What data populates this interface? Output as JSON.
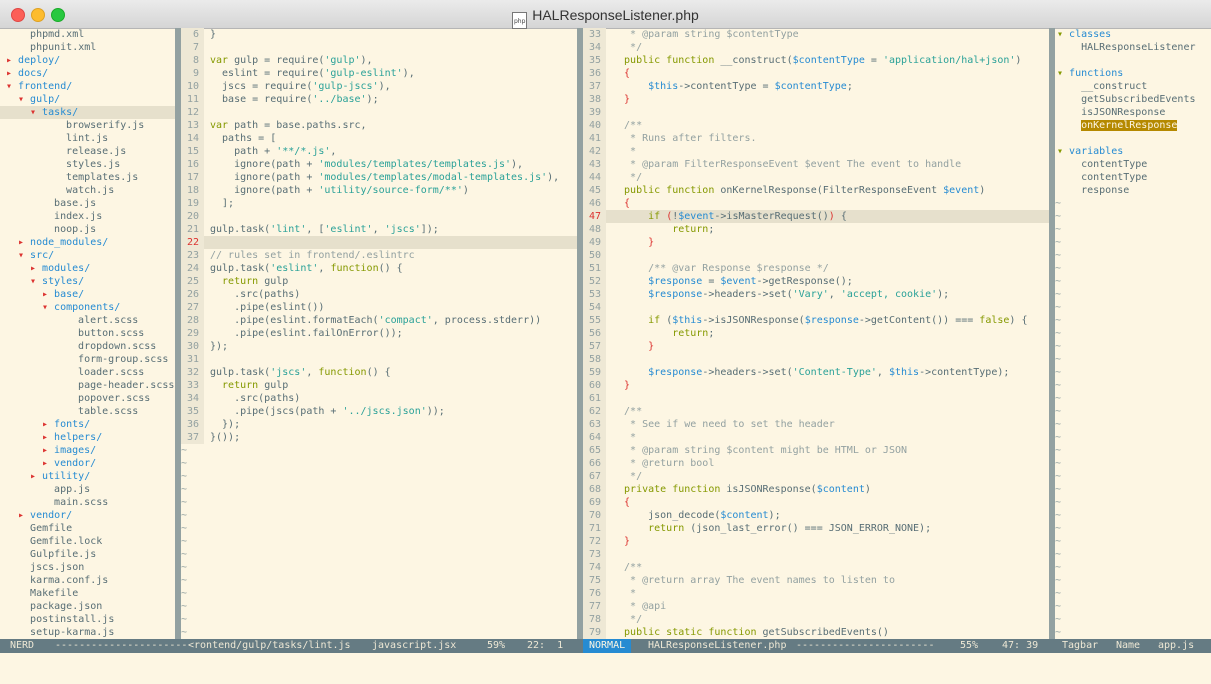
{
  "window": {
    "title": "HALResponseListener.php"
  },
  "tree": [
    {
      "i": 1,
      "t": "phpmd.xml",
      "k": "f"
    },
    {
      "i": 1,
      "t": "phpunit.xml",
      "k": "f"
    },
    {
      "i": 0,
      "t": "deploy/",
      "k": "dc"
    },
    {
      "i": 0,
      "t": "docs/",
      "k": "dc"
    },
    {
      "i": 0,
      "t": "frontend/",
      "k": "do"
    },
    {
      "i": 1,
      "t": "gulp/",
      "k": "do"
    },
    {
      "i": 2,
      "t": "tasks/",
      "k": "do",
      "cur": true
    },
    {
      "i": 4,
      "t": "browserify.js",
      "k": "f"
    },
    {
      "i": 4,
      "t": "lint.js",
      "k": "f"
    },
    {
      "i": 4,
      "t": "release.js",
      "k": "f"
    },
    {
      "i": 4,
      "t": "styles.js",
      "k": "f"
    },
    {
      "i": 4,
      "t": "templates.js",
      "k": "f"
    },
    {
      "i": 4,
      "t": "watch.js",
      "k": "f"
    },
    {
      "i": 3,
      "t": "base.js",
      "k": "f"
    },
    {
      "i": 3,
      "t": "index.js",
      "k": "f"
    },
    {
      "i": 3,
      "t": "noop.js",
      "k": "f"
    },
    {
      "i": 1,
      "t": "node_modules/",
      "k": "dc"
    },
    {
      "i": 1,
      "t": "src/",
      "k": "do"
    },
    {
      "i": 2,
      "t": "modules/",
      "k": "dc"
    },
    {
      "i": 2,
      "t": "styles/",
      "k": "do"
    },
    {
      "i": 3,
      "t": "base/",
      "k": "dc"
    },
    {
      "i": 3,
      "t": "components/",
      "k": "do"
    },
    {
      "i": 5,
      "t": "alert.scss",
      "k": "f"
    },
    {
      "i": 5,
      "t": "button.scss",
      "k": "f"
    },
    {
      "i": 5,
      "t": "dropdown.scss",
      "k": "f"
    },
    {
      "i": 5,
      "t": "form-group.scss",
      "k": "f"
    },
    {
      "i": 5,
      "t": "loader.scss",
      "k": "f"
    },
    {
      "i": 5,
      "t": "page-header.scss",
      "k": "f"
    },
    {
      "i": 5,
      "t": "popover.scss",
      "k": "f"
    },
    {
      "i": 5,
      "t": "table.scss",
      "k": "f"
    },
    {
      "i": 3,
      "t": "fonts/",
      "k": "dc"
    },
    {
      "i": 3,
      "t": "helpers/",
      "k": "dc"
    },
    {
      "i": 3,
      "t": "images/",
      "k": "dc"
    },
    {
      "i": 3,
      "t": "vendor/",
      "k": "dc"
    },
    {
      "i": 2,
      "t": "utility/",
      "k": "dc"
    },
    {
      "i": 3,
      "t": "app.js",
      "k": "f"
    },
    {
      "i": 3,
      "t": "main.scss",
      "k": "f"
    },
    {
      "i": 1,
      "t": "vendor/",
      "k": "dc"
    },
    {
      "i": 1,
      "t": "Gemfile",
      "k": "f"
    },
    {
      "i": 1,
      "t": "Gemfile.lock",
      "k": "f"
    },
    {
      "i": 1,
      "t": "Gulpfile.js",
      "k": "f"
    },
    {
      "i": 1,
      "t": "jscs.json",
      "k": "f"
    },
    {
      "i": 1,
      "t": "karma.conf.js",
      "k": "f"
    },
    {
      "i": 1,
      "t": "Makefile",
      "k": "f"
    },
    {
      "i": 1,
      "t": "package.json",
      "k": "f"
    },
    {
      "i": 1,
      "t": "postinstall.js",
      "k": "f"
    },
    {
      "i": 1,
      "t": "setup-karma.js",
      "k": "f"
    }
  ],
  "js": [
    {
      "n": 6,
      "s": [
        [
          "tx",
          "}"
        ]
      ]
    },
    {
      "n": 7,
      "s": []
    },
    {
      "n": 8,
      "s": [
        [
          "kw",
          "var"
        ],
        [
          "tx",
          " gulp = require("
        ],
        [
          "str",
          "'gulp'"
        ],
        [
          "tx",
          "),"
        ]
      ]
    },
    {
      "n": 9,
      "s": [
        [
          "tx",
          "  eslint = require("
        ],
        [
          "str",
          "'gulp-eslint'"
        ],
        [
          "tx",
          "),"
        ]
      ]
    },
    {
      "n": 10,
      "s": [
        [
          "tx",
          "  jscs = require("
        ],
        [
          "str",
          "'gulp-jscs'"
        ],
        [
          "tx",
          "),"
        ]
      ]
    },
    {
      "n": 11,
      "s": [
        [
          "tx",
          "  base = require("
        ],
        [
          "str",
          "'../base'"
        ],
        [
          "tx",
          ");"
        ]
      ]
    },
    {
      "n": 12,
      "s": []
    },
    {
      "n": 13,
      "s": [
        [
          "kw",
          "var"
        ],
        [
          "tx",
          " path = base.paths.src,"
        ]
      ]
    },
    {
      "n": 14,
      "s": [
        [
          "tx",
          "  paths = ["
        ]
      ]
    },
    {
      "n": 15,
      "s": [
        [
          "tx",
          "    path + "
        ],
        [
          "str",
          "'**/*.js'"
        ],
        [
          "tx",
          ","
        ]
      ]
    },
    {
      "n": 16,
      "s": [
        [
          "tx",
          "    ignore(path + "
        ],
        [
          "str",
          "'modules/templates/templates.js'"
        ],
        [
          "tx",
          "),"
        ]
      ]
    },
    {
      "n": 17,
      "s": [
        [
          "tx",
          "    ignore(path + "
        ],
        [
          "str",
          "'modules/templates/modal-templates.js'"
        ],
        [
          "tx",
          "),"
        ]
      ]
    },
    {
      "n": 18,
      "s": [
        [
          "tx",
          "    ignore(path + "
        ],
        [
          "str",
          "'utility/source-form/**'"
        ],
        [
          "tx",
          ")"
        ]
      ]
    },
    {
      "n": 19,
      "s": [
        [
          "tx",
          "  ];"
        ]
      ]
    },
    {
      "n": 20,
      "s": []
    },
    {
      "n": 21,
      "s": [
        [
          "tx",
          "gulp.task("
        ],
        [
          "str",
          "'lint'"
        ],
        [
          "tx",
          ", ["
        ],
        [
          "str",
          "'eslint'"
        ],
        [
          "tx",
          ", "
        ],
        [
          "str",
          "'jscs'"
        ],
        [
          "tx",
          "]);"
        ]
      ]
    },
    {
      "n": 22,
      "s": [],
      "cur": true
    },
    {
      "n": 23,
      "s": [
        [
          "cm",
          "// rules set in frontend/.eslintrc"
        ]
      ]
    },
    {
      "n": 24,
      "s": [
        [
          "tx",
          "gulp.task("
        ],
        [
          "str",
          "'eslint'"
        ],
        [
          "tx",
          ", "
        ],
        [
          "kw",
          "function"
        ],
        [
          "tx",
          "() {"
        ]
      ]
    },
    {
      "n": 25,
      "s": [
        [
          "kw",
          "  return"
        ],
        [
          "tx",
          " gulp"
        ]
      ]
    },
    {
      "n": 26,
      "s": [
        [
          "tx",
          "    .src(paths)"
        ]
      ]
    },
    {
      "n": 27,
      "s": [
        [
          "tx",
          "    .pipe(eslint())"
        ]
      ]
    },
    {
      "n": 28,
      "s": [
        [
          "tx",
          "    .pipe(eslint.formatEach("
        ],
        [
          "str",
          "'compact'"
        ],
        [
          "tx",
          ", process.stderr))"
        ]
      ]
    },
    {
      "n": 29,
      "s": [
        [
          "tx",
          "    .pipe(eslint.failOnError());"
        ]
      ]
    },
    {
      "n": 30,
      "s": [
        [
          "tx",
          "});"
        ]
      ]
    },
    {
      "n": 31,
      "s": []
    },
    {
      "n": 32,
      "s": [
        [
          "tx",
          "gulp.task("
        ],
        [
          "str",
          "'jscs'"
        ],
        [
          "tx",
          ", "
        ],
        [
          "kw",
          "function"
        ],
        [
          "tx",
          "() {"
        ]
      ]
    },
    {
      "n": 33,
      "s": [
        [
          "kw",
          "  return"
        ],
        [
          "tx",
          " gulp"
        ]
      ]
    },
    {
      "n": 34,
      "s": [
        [
          "tx",
          "    .src(paths)"
        ]
      ]
    },
    {
      "n": 35,
      "s": [
        [
          "tx",
          "    .pipe(jscs(path + "
        ],
        [
          "str",
          "'../jscs.json'"
        ],
        [
          "tx",
          "));"
        ]
      ]
    },
    {
      "n": 36,
      "s": [
        [
          "tx",
          "  });"
        ]
      ]
    },
    {
      "n": 37,
      "s": [
        [
          "tx",
          "}());"
        ]
      ]
    }
  ],
  "php": [
    {
      "n": 33,
      "s": [
        [
          "cm",
          "   * @param string $contentType"
        ]
      ]
    },
    {
      "n": 34,
      "s": [
        [
          "cm",
          "   */"
        ]
      ]
    },
    {
      "n": 35,
      "s": [
        [
          "kw",
          "  public function"
        ],
        [
          "tx",
          " __construct("
        ],
        [
          "var",
          "$contentType"
        ],
        [
          "tx",
          " = "
        ],
        [
          "str",
          "'application/hal+json'"
        ],
        [
          "tx",
          ")"
        ]
      ]
    },
    {
      "n": 36,
      "s": [
        [
          "arr",
          "  {"
        ]
      ]
    },
    {
      "n": 37,
      "s": [
        [
          "tx",
          "      "
        ],
        [
          "var",
          "$this"
        ],
        [
          "tx",
          "->contentType = "
        ],
        [
          "var",
          "$contentType"
        ],
        [
          "tx",
          ";"
        ]
      ]
    },
    {
      "n": 38,
      "s": [
        [
          "arr",
          "  }"
        ]
      ]
    },
    {
      "n": 39,
      "s": []
    },
    {
      "n": 40,
      "s": [
        [
          "cm",
          "  /**"
        ]
      ]
    },
    {
      "n": 41,
      "s": [
        [
          "cm",
          "   * Runs after filters."
        ]
      ]
    },
    {
      "n": 42,
      "s": [
        [
          "cm",
          "   *"
        ]
      ]
    },
    {
      "n": 43,
      "s": [
        [
          "cm",
          "   * @param FilterResponseEvent $event The event to handle"
        ]
      ]
    },
    {
      "n": 44,
      "s": [
        [
          "cm",
          "   */"
        ]
      ]
    },
    {
      "n": 45,
      "s": [
        [
          "kw",
          "  public function"
        ],
        [
          "tx",
          " onKernelResponse(FilterResponseEvent "
        ],
        [
          "var",
          "$event"
        ],
        [
          "tx",
          ")"
        ]
      ]
    },
    {
      "n": 46,
      "s": [
        [
          "arr",
          "  {"
        ]
      ]
    },
    {
      "n": 47,
      "s": [
        [
          "kw",
          "      if"
        ],
        [
          "tx",
          " "
        ],
        [
          "arr",
          "("
        ],
        [
          "tx",
          "!"
        ],
        [
          "var",
          "$event"
        ],
        [
          "tx",
          "->isMasterRequest()"
        ],
        [
          "arr",
          ")"
        ],
        [
          "tx",
          " {"
        ]
      ],
      "cur": true
    },
    {
      "n": 48,
      "s": [
        [
          "kw",
          "          return"
        ],
        [
          "tx",
          ";"
        ]
      ]
    },
    {
      "n": 49,
      "s": [
        [
          "arr",
          "      }"
        ]
      ]
    },
    {
      "n": 50,
      "s": []
    },
    {
      "n": 51,
      "s": [
        [
          "cm",
          "      /** @var Response $response */"
        ]
      ]
    },
    {
      "n": 52,
      "s": [
        [
          "tx",
          "      "
        ],
        [
          "var",
          "$response"
        ],
        [
          "tx",
          " = "
        ],
        [
          "var",
          "$event"
        ],
        [
          "tx",
          "->getResponse();"
        ]
      ]
    },
    {
      "n": 53,
      "s": [
        [
          "tx",
          "      "
        ],
        [
          "var",
          "$response"
        ],
        [
          "tx",
          "->headers->set("
        ],
        [
          "str",
          "'Vary'"
        ],
        [
          "tx",
          ", "
        ],
        [
          "str",
          "'accept, cookie'"
        ],
        [
          "tx",
          ");"
        ]
      ]
    },
    {
      "n": 54,
      "s": []
    },
    {
      "n": 55,
      "s": [
        [
          "kw",
          "      if"
        ],
        [
          "tx",
          " ("
        ],
        [
          "var",
          "$this"
        ],
        [
          "tx",
          "->isJSONResponse("
        ],
        [
          "var",
          "$response"
        ],
        [
          "tx",
          "->getContent()) === "
        ],
        [
          "kw",
          "false"
        ],
        [
          "tx",
          ") {"
        ]
      ]
    },
    {
      "n": 56,
      "s": [
        [
          "kw",
          "          return"
        ],
        [
          "tx",
          ";"
        ]
      ]
    },
    {
      "n": 57,
      "s": [
        [
          "arr",
          "      }"
        ]
      ]
    },
    {
      "n": 58,
      "s": []
    },
    {
      "n": 59,
      "s": [
        [
          "tx",
          "      "
        ],
        [
          "var",
          "$response"
        ],
        [
          "tx",
          "->headers->set("
        ],
        [
          "str",
          "'Content-Type'"
        ],
        [
          "tx",
          ", "
        ],
        [
          "var",
          "$this"
        ],
        [
          "tx",
          "->contentType);"
        ]
      ]
    },
    {
      "n": 60,
      "s": [
        [
          "arr",
          "  }"
        ]
      ]
    },
    {
      "n": 61,
      "s": []
    },
    {
      "n": 62,
      "s": [
        [
          "cm",
          "  /**"
        ]
      ]
    },
    {
      "n": 63,
      "s": [
        [
          "cm",
          "   * See if we need to set the header"
        ]
      ]
    },
    {
      "n": 64,
      "s": [
        [
          "cm",
          "   *"
        ]
      ]
    },
    {
      "n": 65,
      "s": [
        [
          "cm",
          "   * @param string $content might be HTML or JSON"
        ]
      ]
    },
    {
      "n": 66,
      "s": [
        [
          "cm",
          "   * @return bool"
        ]
      ]
    },
    {
      "n": 67,
      "s": [
        [
          "cm",
          "   */"
        ]
      ]
    },
    {
      "n": 68,
      "s": [
        [
          "kw",
          "  private function"
        ],
        [
          "tx",
          " isJSONResponse("
        ],
        [
          "var",
          "$content"
        ],
        [
          "tx",
          ")"
        ]
      ]
    },
    {
      "n": 69,
      "s": [
        [
          "arr",
          "  {"
        ]
      ]
    },
    {
      "n": 70,
      "s": [
        [
          "tx",
          "      json_decode("
        ],
        [
          "var",
          "$content"
        ],
        [
          "tx",
          ");"
        ]
      ]
    },
    {
      "n": 71,
      "s": [
        [
          "kw",
          "      return"
        ],
        [
          "tx",
          " (json_last_error() === JSON_ERROR_NONE);"
        ]
      ]
    },
    {
      "n": 72,
      "s": [
        [
          "arr",
          "  }"
        ]
      ]
    },
    {
      "n": 73,
      "s": []
    },
    {
      "n": 74,
      "s": [
        [
          "cm",
          "  /**"
        ]
      ]
    },
    {
      "n": 75,
      "s": [
        [
          "cm",
          "   * @return array The event names to listen to"
        ]
      ]
    },
    {
      "n": 76,
      "s": [
        [
          "cm",
          "   *"
        ]
      ]
    },
    {
      "n": 77,
      "s": [
        [
          "cm",
          "   * @api"
        ]
      ]
    },
    {
      "n": 78,
      "s": [
        [
          "cm",
          "   */"
        ]
      ]
    },
    {
      "n": 79,
      "s": [
        [
          "kw",
          "  public static function"
        ],
        [
          "tx",
          " getSubscribedEvents()"
        ]
      ]
    }
  ],
  "tagbar": [
    {
      "t": "classes",
      "k": "h"
    },
    {
      "t": "HALResponseListener",
      "k": "e"
    },
    {
      "t": "",
      "k": "b"
    },
    {
      "t": "functions",
      "k": "h"
    },
    {
      "t": "__construct",
      "k": "e"
    },
    {
      "t": "getSubscribedEvents",
      "k": "e"
    },
    {
      "t": "isJSONResponse",
      "k": "e"
    },
    {
      "t": "onKernelResponse",
      "k": "e",
      "hl": true
    },
    {
      "t": "",
      "k": "b"
    },
    {
      "t": "variables",
      "k": "h"
    },
    {
      "t": "contentType",
      "k": "e"
    },
    {
      "t": "contentType",
      "k": "e"
    },
    {
      "t": "response",
      "k": "e"
    }
  ],
  "status": {
    "tree_label": "NERD",
    "tree_fill": "----------------------",
    "js_file": "<rontend/gulp/tasks/lint.js",
    "js_type": "javascript.jsx",
    "js_pct": "59%",
    "js_pos": "22:  1",
    "mode": "NORMAL",
    "php_file": "HALResponseListener.php",
    "php_fill": "-----------------------",
    "php_pct": "55%",
    "php_pos": "47: 39",
    "tagbar": "Tagbar",
    "tagbar_sort": "Name",
    "tagbar_file": "app.js"
  }
}
